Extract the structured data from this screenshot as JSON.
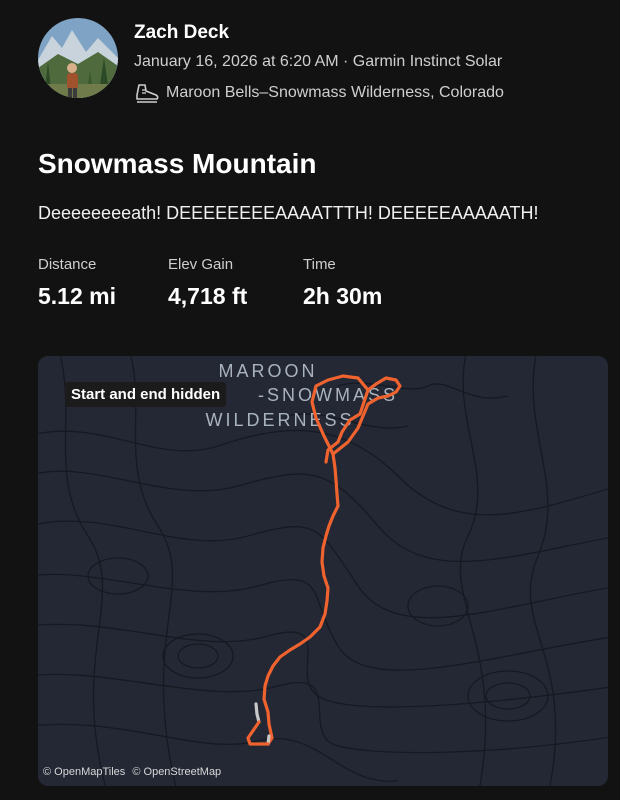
{
  "athlete": {
    "name": "Zach Deck",
    "meta": "January 16, 2026 at 6:20 AM · Garmin Instinct Solar",
    "location": "Maroon Bells–Snowmass Wilderness, Colorado",
    "location_icon": "hiking-shoe-icon"
  },
  "activity": {
    "title": "Snowmass Mountain",
    "description": "Deeeeeeeeath! DEEEEEEEEAAAATTTH! DEEEEEAAAAATH!"
  },
  "stats": [
    {
      "label": "Distance",
      "value": "5.12 mi"
    },
    {
      "label": "Elev Gain",
      "value": "4,718 ft"
    },
    {
      "label": "Time",
      "value": "2h 30m"
    }
  ],
  "map": {
    "badge": "Start and end hidden",
    "area_label_line1": "MAROON",
    "area_label_line2": "-SNOWMASS",
    "area_label_line3": "WILDERNESS",
    "attribution_1": "© OpenMapTiles",
    "attribution_2": "© OpenStreetMap",
    "route_color": "#f0632f",
    "hidden_segment_color": "#c8c8c8"
  }
}
